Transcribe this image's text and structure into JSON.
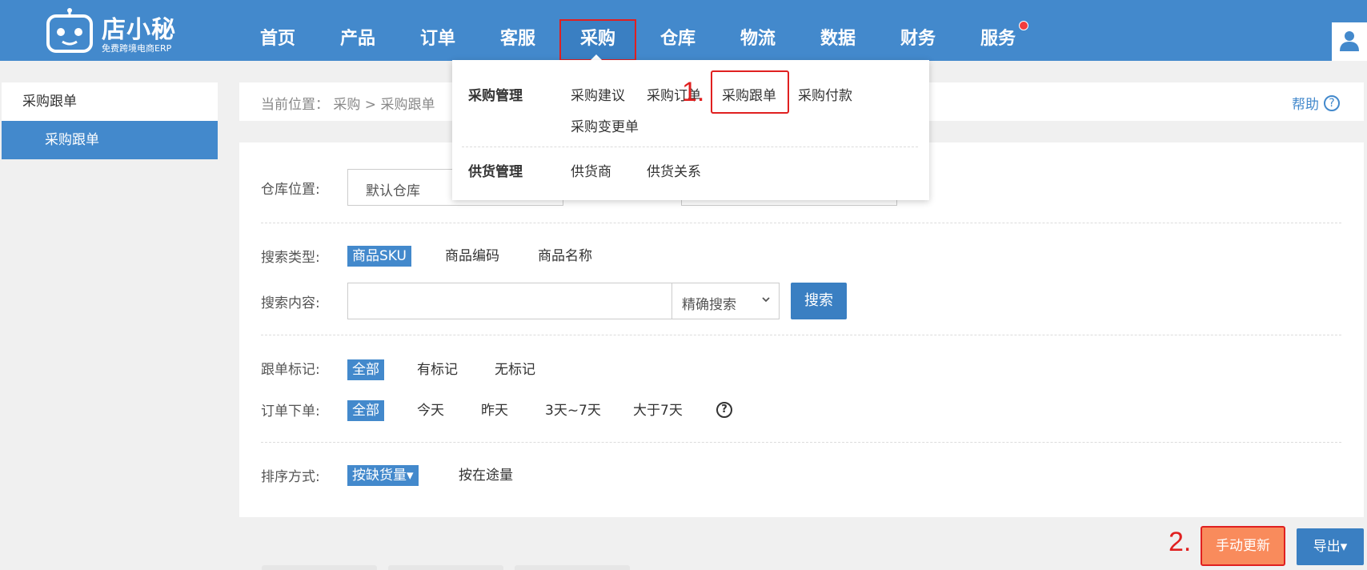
{
  "brand": {
    "name": "店小秘",
    "slogan": "免费跨境电商ERP"
  },
  "nav": [
    {
      "label": "首页"
    },
    {
      "label": "产品"
    },
    {
      "label": "订单"
    },
    {
      "label": "客服"
    },
    {
      "label": "采购"
    },
    {
      "label": "仓库"
    },
    {
      "label": "物流"
    },
    {
      "label": "数据"
    },
    {
      "label": "财务"
    },
    {
      "label": "服务"
    }
  ],
  "sidebar": {
    "header": "采购跟单",
    "items": [
      {
        "label": "采购跟单"
      }
    ]
  },
  "breadcrumb": {
    "text": "当前位置： 采购 > 采购跟单",
    "help": "帮助"
  },
  "dropdown": {
    "group1": "采购管理",
    "group1_links": [
      "采购建议",
      "采购订单",
      "采购跟单",
      "采购付款",
      "采购变更单"
    ],
    "group2": "供货管理",
    "group2_links": [
      "供货商",
      "供货关系"
    ],
    "step1": "1.",
    "step2": "2."
  },
  "filters": {
    "warehouse_label": "仓库位置:",
    "warehouse_value": "默认仓库",
    "search_type_label": "搜索类型:",
    "search_types": [
      "商品SKU",
      "商品编码",
      "商品名称"
    ],
    "search_content_label": "搜索内容:",
    "search_value": "",
    "search_mode": "精确搜索",
    "search_button": "搜索",
    "mark_label": "跟单标记:",
    "marks": [
      "全部",
      "有标记",
      "无标记"
    ],
    "order_label": "订单下单:",
    "order_ranges": [
      "全部",
      "今天",
      "昨天",
      "3天~7天",
      "大于7天"
    ],
    "sort_label": "排序方式:",
    "sorts": [
      "按缺货量▾",
      "按在途量"
    ]
  },
  "actions": {
    "update": "手动更新",
    "export": "导出▾"
  },
  "colors": {
    "primary": "#4389cc",
    "accent": "#f98b5c",
    "highlight": "#e02020"
  }
}
